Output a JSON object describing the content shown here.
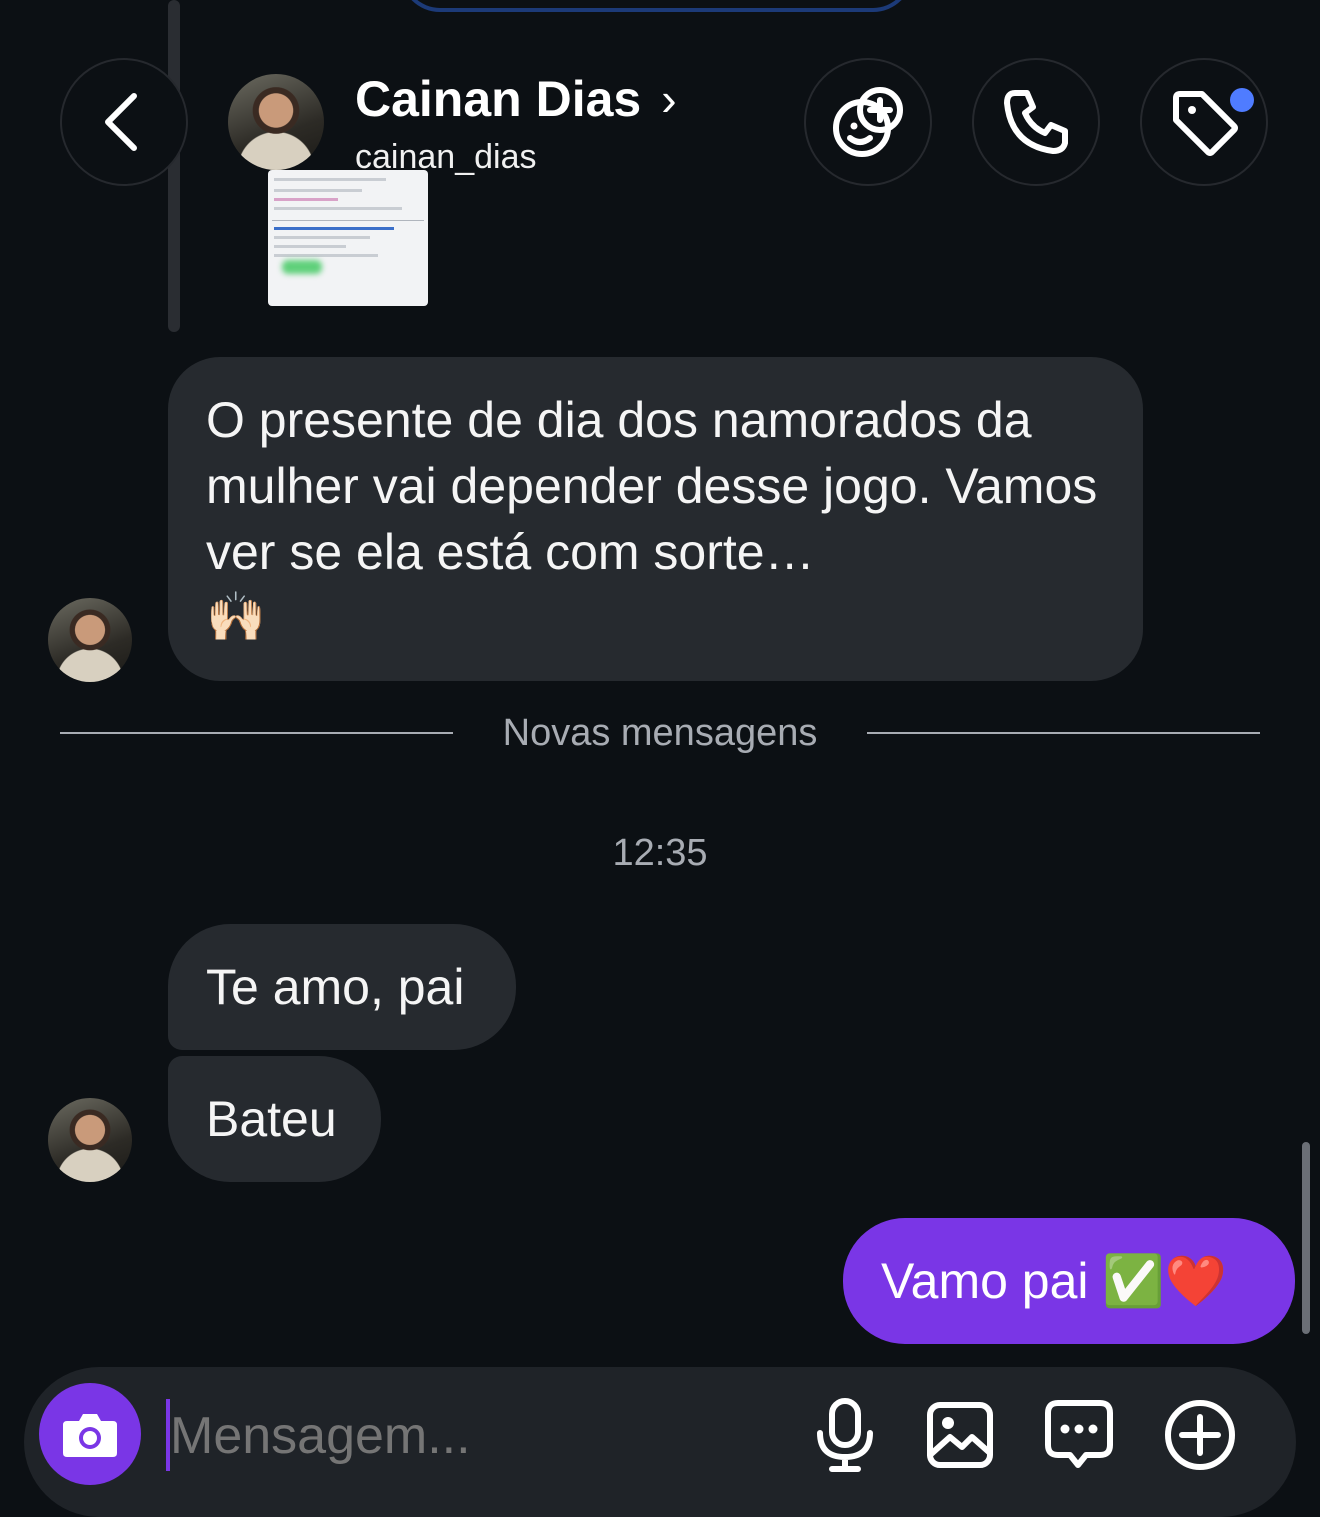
{
  "header": {
    "name": "Cainan Dias",
    "username": "cainan_dias",
    "chevron": "›"
  },
  "messages": {
    "incoming_long": "O presente de dia dos namorados da mulher vai depender desse jogo. Vamos ver se ela está com sorte…",
    "incoming_long_emoji": "🙌🏻",
    "new_messages_label": "Novas mensagens",
    "timestamp": "12:35",
    "incoming_1": "Te amo, pai",
    "incoming_2": "Bateu",
    "outgoing_1": "Vamo pai ✅❤️"
  },
  "composer": {
    "placeholder": "Mensagem..."
  },
  "icons": {
    "back": "chevron-left-icon",
    "sticker": "sticker-add-icon",
    "call": "phone-icon",
    "tag": "tag-icon",
    "camera": "camera-icon",
    "mic": "microphone-icon",
    "gallery": "image-icon",
    "chat": "chat-bubble-icon",
    "plus": "plus-circle-icon"
  },
  "colors": {
    "background": "#0c1014",
    "incoming_bubble": "#262a2f",
    "outgoing_bubble": "#7a36e6",
    "notification_dot": "#4f7cff"
  }
}
